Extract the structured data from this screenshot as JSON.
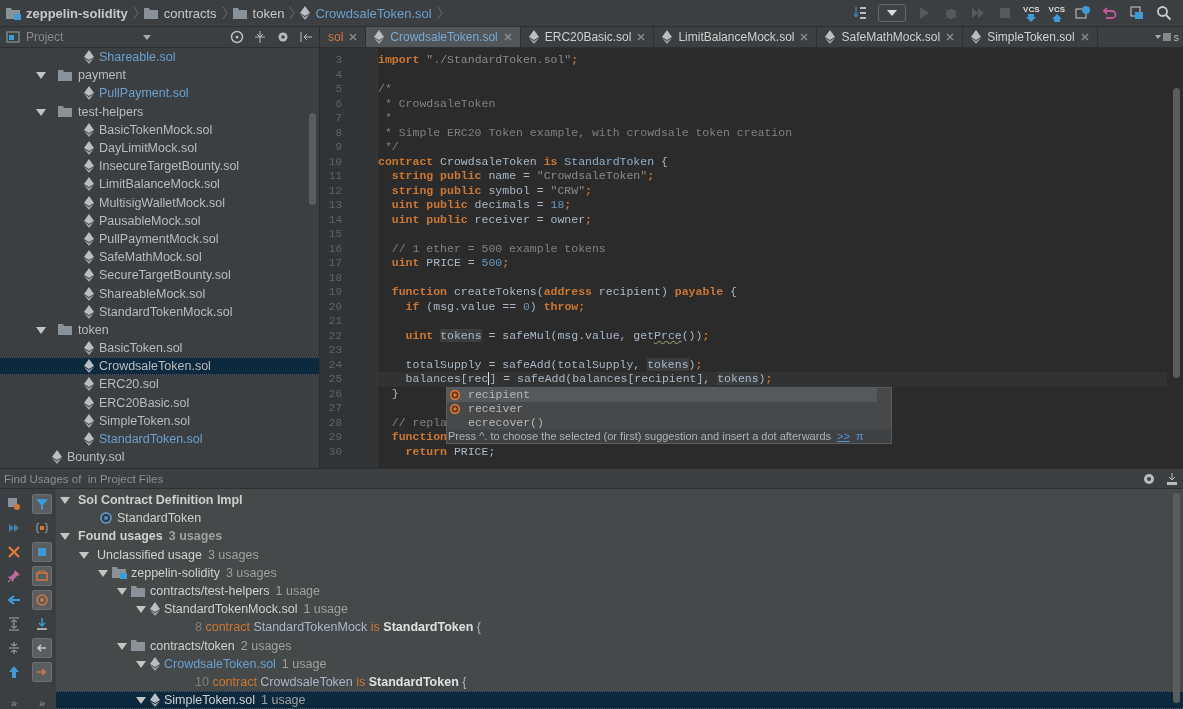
{
  "breadcrumbs": [
    {
      "label": "zeppelin-solidity",
      "kind": "module",
      "current": false
    },
    {
      "label": "contracts",
      "kind": "folder",
      "current": false
    },
    {
      "label": "token",
      "kind": "folder",
      "current": false
    },
    {
      "label": "CrowdsaleToken.sol",
      "kind": "file",
      "current": true
    }
  ],
  "vcs_buttons": [
    {
      "label": "VCS",
      "kind": "update"
    },
    {
      "label": "VCS",
      "kind": "commit"
    }
  ],
  "project_panel": {
    "title": "Project"
  },
  "project_tree": [
    {
      "children": [
        {
          "label": "Shareable.sol",
          "kind": "file",
          "modified": true,
          "selected": false
        }
      ]
    },
    {
      "label": "payment",
      "kind": "folder",
      "expanded": true,
      "selected": false,
      "children": [
        {
          "label": "PullPayment.sol",
          "kind": "file",
          "modified": true,
          "selected": false
        }
      ]
    },
    {
      "label": "test-helpers",
      "kind": "folder",
      "expanded": true,
      "selected": false,
      "children": [
        {
          "label": "BasicTokenMock.sol",
          "kind": "file",
          "modified": false,
          "selected": false
        },
        {
          "label": "DayLimitMock.sol",
          "kind": "file",
          "modified": false,
          "selected": false
        },
        {
          "label": "InsecureTargetBounty.sol",
          "kind": "file",
          "modified": false,
          "selected": false
        },
        {
          "label": "LimitBalanceMock.sol",
          "kind": "file",
          "modified": false,
          "selected": false
        },
        {
          "label": "MultisigWalletMock.sol",
          "kind": "file",
          "modified": false,
          "selected": false
        },
        {
          "label": "PausableMock.sol",
          "kind": "file",
          "modified": false,
          "selected": false
        },
        {
          "label": "PullPaymentMock.sol",
          "kind": "file",
          "modified": false,
          "selected": false
        },
        {
          "label": "SafeMathMock.sol",
          "kind": "file",
          "modified": false,
          "selected": false
        },
        {
          "label": "SecureTargetBounty.sol",
          "kind": "file",
          "modified": false,
          "selected": false
        },
        {
          "label": "ShareableMock.sol",
          "kind": "file",
          "modified": false,
          "selected": false
        },
        {
          "label": "StandardTokenMock.sol",
          "kind": "file",
          "modified": false,
          "selected": false
        }
      ]
    },
    {
      "label": "token",
      "kind": "folder",
      "expanded": true,
      "selected": false,
      "children": [
        {
          "label": "BasicToken.sol",
          "kind": "file",
          "modified": false,
          "selected": false
        },
        {
          "label": "CrowdsaleToken.sol",
          "kind": "file",
          "modified": false,
          "selected": true
        },
        {
          "label": "ERC20.sol",
          "kind": "file",
          "modified": false,
          "selected": false
        },
        {
          "label": "ERC20Basic.sol",
          "kind": "file",
          "modified": false,
          "selected": false
        },
        {
          "label": "SimpleToken.sol",
          "kind": "file",
          "modified": false,
          "selected": false
        },
        {
          "label": "StandardToken.sol",
          "kind": "file",
          "modified": true,
          "selected": false
        }
      ]
    },
    {
      "label": "Bounty.sol",
      "kind": "file",
      "modified": false,
      "selected": false
    }
  ],
  "tabs": [
    {
      "label": "sol",
      "selected": false,
      "problem": true
    },
    {
      "label": "CrowdsaleToken.sol",
      "selected": true,
      "problem": false
    },
    {
      "label": "ERC20Basic.sol",
      "selected": false,
      "problem": false
    },
    {
      "label": "LimitBalanceMock.sol",
      "selected": false,
      "problem": false
    },
    {
      "label": "SafeMathMock.sol",
      "selected": false,
      "problem": false
    },
    {
      "label": "SimpleToken.sol",
      "selected": false,
      "problem": false
    }
  ],
  "tabs_overflow_label": "s",
  "code_lines": [
    {
      "n": "3",
      "tokens": [
        {
          "kind": "kw",
          "text": "import"
        },
        {
          "kind": "str",
          "text": " \"./StandardToken.sol\""
        },
        {
          "kind": "kw",
          "text": ";"
        }
      ]
    },
    {
      "n": "4"
    },
    {
      "n": "5",
      "tokens": [
        {
          "kind": "comment",
          "text": "/*"
        }
      ]
    },
    {
      "n": "6",
      "tokens": [
        {
          "kind": "comment",
          "text": " * CrowdsaleToken"
        }
      ]
    },
    {
      "n": "7",
      "tokens": [
        {
          "kind": "comment",
          "text": " *"
        }
      ]
    },
    {
      "n": "8",
      "tokens": [
        {
          "kind": "comment",
          "text": " * Simple ERC20 Token example, with crowdsale token creation"
        }
      ]
    },
    {
      "n": "9",
      "tokens": [
        {
          "kind": "comment",
          "text": " */"
        }
      ]
    },
    {
      "n": "10",
      "tokens": [
        {
          "kind": "kw",
          "text": "contract"
        },
        {
          "kind": "plain",
          "text": " CrowdsaleToken "
        },
        {
          "kind": "kw",
          "text": "is"
        },
        {
          "kind": "type",
          "text": " StandardToken"
        },
        {
          "kind": "plain",
          "text": " {"
        }
      ]
    },
    {
      "n": "11",
      "tokens": [
        {
          "kind": "kw",
          "text": "  string public"
        },
        {
          "kind": "plain",
          "text": " name = "
        },
        {
          "kind": "str",
          "text": "\"CrowdsaleToken\""
        },
        {
          "kind": "kw",
          "text": ";"
        }
      ]
    },
    {
      "n": "12",
      "tokens": [
        {
          "kind": "kw",
          "text": "  string public"
        },
        {
          "kind": "plain",
          "text": " symbol = "
        },
        {
          "kind": "str",
          "text": "\"CRW\""
        },
        {
          "kind": "kw",
          "text": ";"
        }
      ]
    },
    {
      "n": "13",
      "tokens": [
        {
          "kind": "kw",
          "text": "  uint public"
        },
        {
          "kind": "plain",
          "text": " decimals = "
        },
        {
          "kind": "num",
          "text": "18"
        },
        {
          "kind": "kw",
          "text": ";"
        }
      ]
    },
    {
      "n": "14",
      "tokens": [
        {
          "kind": "kw",
          "text": "  uint public"
        },
        {
          "kind": "plain",
          "text": " receiver = owner"
        },
        {
          "kind": "kw",
          "text": ";"
        }
      ]
    },
    {
      "n": "15"
    },
    {
      "n": "16",
      "tokens": [
        {
          "kind": "comment",
          "text": "  // 1 ether = 500 example tokens"
        }
      ]
    },
    {
      "n": "17",
      "tokens": [
        {
          "kind": "kw",
          "text": "  uint"
        },
        {
          "kind": "plain",
          "text": " PRICE = "
        },
        {
          "kind": "num",
          "text": "500"
        },
        {
          "kind": "kw",
          "text": ";"
        }
      ]
    },
    {
      "n": "18"
    },
    {
      "n": "19",
      "tokens": [
        {
          "kind": "kw",
          "text": "  function"
        },
        {
          "kind": "plain",
          "text": " createTokens("
        },
        {
          "kind": "kw",
          "text": "address"
        },
        {
          "kind": "plain",
          "text": " recipient) "
        },
        {
          "kind": "kw",
          "text": "payable"
        },
        {
          "kind": "plain",
          "text": " {"
        }
      ]
    },
    {
      "n": "20",
      "tokens": [
        {
          "kind": "kw",
          "text": "    if"
        },
        {
          "kind": "plain",
          "text": " (msg.value == "
        },
        {
          "kind": "num",
          "text": "0"
        },
        {
          "kind": "plain",
          "text": ") "
        },
        {
          "kind": "kw",
          "text": "throw;"
        }
      ]
    },
    {
      "n": "21"
    },
    {
      "n": "22",
      "tokens": [
        {
          "kind": "kw",
          "text": "    uint "
        },
        {
          "kind": "ref",
          "text": "tokens"
        },
        {
          "kind": "plain",
          "text": " = safeMul(msg.value, get"
        },
        {
          "kind": "typo",
          "text": "Prce"
        },
        {
          "kind": "plain",
          "text": "())"
        },
        {
          "kind": "kw",
          "text": ";"
        }
      ]
    },
    {
      "n": "23"
    },
    {
      "n": "24",
      "tokens": [
        {
          "kind": "plain",
          "text": "    totalSupply = safeAdd(totalSupply, "
        },
        {
          "kind": "ref",
          "text": "tokens"
        },
        {
          "kind": "plain",
          "text": ")"
        },
        {
          "kind": "kw",
          "text": ";"
        }
      ]
    },
    {
      "n": "25",
      "current": true,
      "tokens": [
        {
          "kind": "plain",
          "text": "    balances[rec"
        },
        {
          "kind": "caret"
        },
        {
          "kind": "plain",
          "text": "] = safeAdd(balances[recipient], "
        },
        {
          "kind": "ref",
          "text": "tokens"
        },
        {
          "kind": "plain",
          "text": ")"
        },
        {
          "kind": "kw",
          "text": ";"
        }
      ]
    },
    {
      "n": "26",
      "tokens": [
        {
          "kind": "plain",
          "text": "  }"
        }
      ]
    },
    {
      "n": "27"
    },
    {
      "n": "28",
      "tokens": [
        {
          "kind": "comment",
          "text": "  // repla"
        }
      ]
    },
    {
      "n": "29",
      "tokens": [
        {
          "kind": "kw",
          "text": "  function"
        }
      ]
    },
    {
      "n": "30",
      "tokens": [
        {
          "kind": "kw",
          "text": "    return"
        },
        {
          "kind": "plain",
          "text": " PRICE;"
        }
      ]
    }
  ],
  "completion": {
    "items": [
      {
        "label": "recipient",
        "kind": "variable",
        "selected": true
      },
      {
        "label": "receiver",
        "kind": "variable",
        "selected": false
      },
      {
        "label": "ecrecover()",
        "kind": "function",
        "selected": false
      }
    ],
    "hint": "Press ^. to choose the selected (or first) suggestion and insert a dot afterwards",
    "hint_link": ">>",
    "hint_symbol": "π"
  },
  "find_panel": {
    "title": "Find Usages of  in Project Files",
    "toggles": [
      {
        "on": true
      },
      {
        "on": false
      },
      {
        "on": true
      },
      {
        "on": true
      },
      {
        "on": true
      },
      {
        "on": false
      },
      {
        "on": true
      },
      {
        "on": true
      }
    ],
    "more": [
      "»",
      "»"
    ]
  },
  "usages": [
    {
      "label": "Sol Contract Definition Impl",
      "kind": "group",
      "expanded": true,
      "selected": false,
      "children": [
        {
          "label": "StandardToken",
          "kind": "definition",
          "selected": false
        }
      ]
    },
    {
      "label": "Found usages",
      "count": "3 usages",
      "kind": "group",
      "expanded": true,
      "selected": false,
      "children": [
        {
          "label": "Unclassified usage",
          "count": "3 usages",
          "kind": "category",
          "expanded": true,
          "selected": false,
          "children": [
            {
              "label": "zeppelin-solidity",
              "count": "3 usages",
              "kind": "module",
              "expanded": true,
              "selected": false,
              "children": [
                {
                  "label": "contracts/test-helpers",
                  "count": "1 usage",
                  "kind": "folder",
                  "expanded": true,
                  "selected": false,
                  "children": [
                    {
                      "label": "StandardTokenMock.sol",
                      "count": "1 usage",
                      "kind": "file",
                      "modified": false,
                      "expanded": true,
                      "selected": false,
                      "children": [
                        {
                          "kind": "line",
                          "line_number": "8",
                          "selected": false,
                          "tokens": [
                            {
                              "kind": "kw",
                              "text": "contract"
                            },
                            {
                              "kind": "plain",
                              "text": " StandardTokenMock "
                            },
                            {
                              "kind": "kw",
                              "text": "is"
                            },
                            {
                              "kind": "match",
                              "text": " StandardToken"
                            },
                            {
                              "kind": "plain",
                              "text": " {"
                            }
                          ]
                        }
                      ]
                    }
                  ]
                },
                {
                  "label": "contracts/token",
                  "count": "2 usages",
                  "kind": "folder",
                  "expanded": true,
                  "selected": false,
                  "children": [
                    {
                      "label": "CrowdsaleToken.sol",
                      "count": "1 usage",
                      "kind": "file",
                      "modified": true,
                      "expanded": true,
                      "selected": false,
                      "children": [
                        {
                          "kind": "line",
                          "line_number": "10",
                          "selected": false,
                          "tokens": [
                            {
                              "kind": "kw",
                              "text": "contract"
                            },
                            {
                              "kind": "plain",
                              "text": " CrowdsaleToken "
                            },
                            {
                              "kind": "kw",
                              "text": "is"
                            },
                            {
                              "kind": "match",
                              "text": " StandardToken"
                            },
                            {
                              "kind": "plain",
                              "text": " {"
                            }
                          ]
                        }
                      ]
                    },
                    {
                      "label": "SimpleToken.sol",
                      "count": "1 usage",
                      "kind": "file",
                      "modified": false,
                      "expanded": true,
                      "selected": true
                    }
                  ]
                }
              ]
            }
          ]
        }
      ]
    }
  ]
}
